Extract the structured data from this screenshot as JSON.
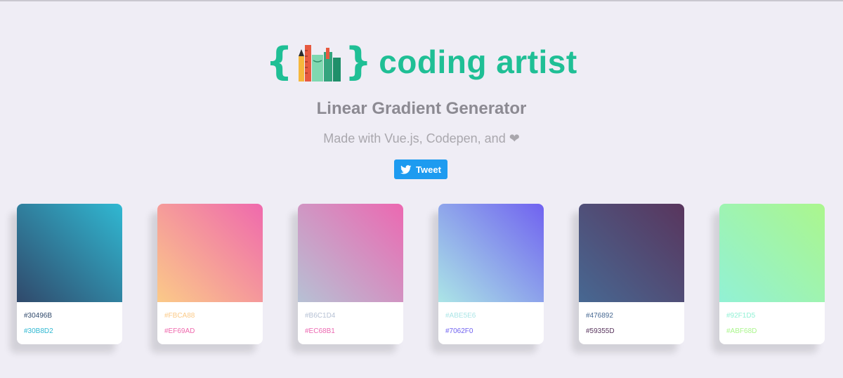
{
  "header": {
    "brace_left": "{",
    "brace_right": "}",
    "logo_text": "coding artist",
    "logo_icon": "pencil-ruler-books-icon"
  },
  "subtitle": "Linear Gradient Generator",
  "tagline": "Made with Vue.js, Codepen, and ❤",
  "tweet": {
    "label": "Tweet",
    "icon": "twitter-bird-icon"
  },
  "cards": [
    {
      "color1": "#30496B",
      "color2": "#30B8D2"
    },
    {
      "color1": "#FBCA88",
      "color2": "#EF69AD"
    },
    {
      "color1": "#B6C1D4",
      "color2": "#EC68B1"
    },
    {
      "color1": "#ABE5E6",
      "color2": "#7062F0"
    },
    {
      "color1": "#476892",
      "color2": "#59355D"
    },
    {
      "color1": "#92F1D5",
      "color2": "#ABF68D"
    }
  ]
}
